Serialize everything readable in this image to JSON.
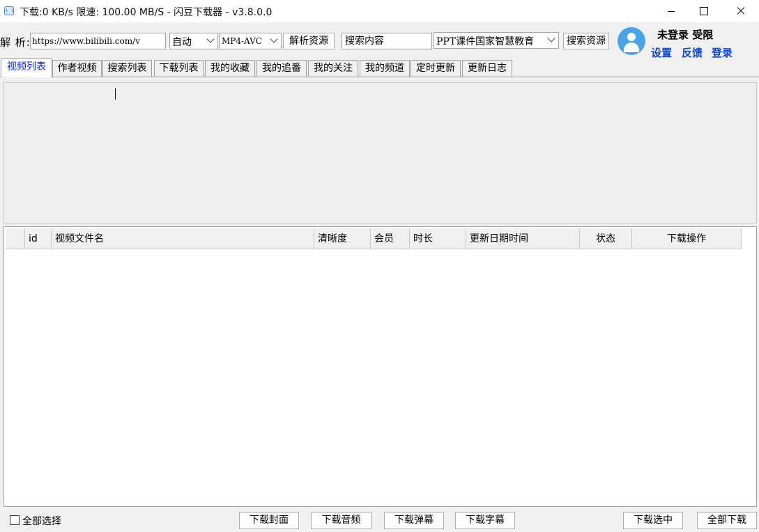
{
  "window": {
    "title": "下载:0 KB/s  限速: 100.00 MB/S  - 闪豆下载器 - v3.8.0.0"
  },
  "toolbar": {
    "parse_label": "解 析:",
    "url_value": "https://www.bilibili.com/v",
    "quality_value": "自动",
    "codec_value": "MP4-AVC",
    "parse_button": "解析资源",
    "search_value": "搜索内容",
    "search_source_value": "PPT课件国家智慧教育",
    "search_button": "搜索资源"
  },
  "account": {
    "status": "未登录 受限",
    "settings": "设置",
    "feedback": "反馈",
    "login": "登录"
  },
  "tabs": [
    "视频列表",
    "作者视频",
    "搜索列表",
    "下载列表",
    "我的收藏",
    "我的追番",
    "我的关注",
    "我的频道",
    "定时更新",
    "更新日志"
  ],
  "active_tab": "视频列表",
  "table": {
    "columns": [
      "",
      "id",
      "视频文件名",
      "清晰度",
      "会员",
      "时长",
      "更新日期时间",
      "状态",
      "下载操作"
    ],
    "rows": []
  },
  "footer": {
    "select_all": "全部选择",
    "download_cover": "下载封面",
    "download_audio": "下载音频",
    "download_danmaku": "下载弹幕",
    "download_subtitle": "下载字幕",
    "download_selected": "下载选中",
    "download_all": "全部下载"
  },
  "colors": {
    "link": "#0b45d8",
    "active_tab_text": "#0a24d6",
    "avatar": "#4aa3e4"
  }
}
